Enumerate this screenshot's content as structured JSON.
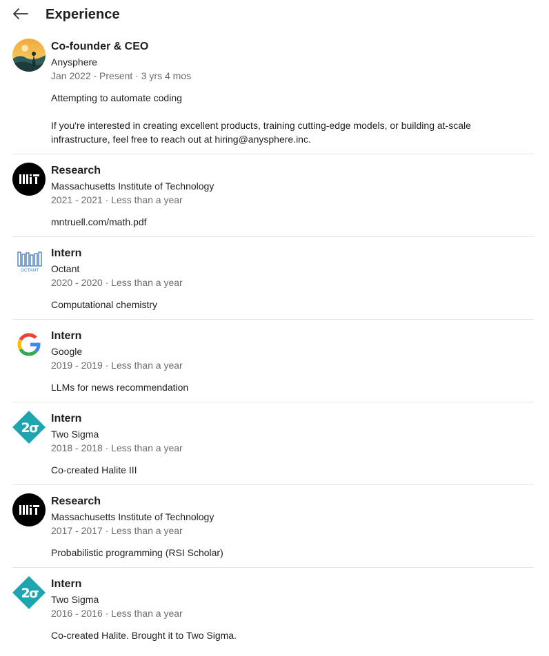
{
  "header": {
    "title": "Experience",
    "back_icon": "arrow-left-icon"
  },
  "experiences": [
    {
      "role": "Co-founder & CEO",
      "company": "Anysphere",
      "dates": "Jan 2022 - Present · 3 yrs 4 mos",
      "desc1": "Attempting to automate coding",
      "desc2": "If you're interested in creating excellent products, training cutting-edge models, or building at-scale",
      "desc3": "infrastructure, feel free to reach out at hiring@anysphere.inc.",
      "logo": "anysphere-logo"
    },
    {
      "role": "Research",
      "company": "Massachusetts Institute of Technology",
      "dates": "2021 - 2021 · Less than a year",
      "desc1": "mntruell.com/math.pdf",
      "logo": "mit-logo"
    },
    {
      "role": "Intern",
      "company": "Octant",
      "dates": "2020 - 2020 · Less than a year",
      "desc1": "Computational chemistry",
      "logo": "octant-logo",
      "logo_text": "OCTANT"
    },
    {
      "role": "Intern",
      "company": "Google",
      "dates": "2019 - 2019 · Less than a year",
      "desc1": "LLMs for news recommendation",
      "logo": "google-logo"
    },
    {
      "role": "Intern",
      "company": "Two Sigma",
      "dates": "2018 - 2018 · Less than a year",
      "desc1": "Co-created Halite III",
      "logo": "two-sigma-logo"
    },
    {
      "role": "Research",
      "company": "Massachusetts Institute of Technology",
      "dates": "2017 - 2017 · Less than a year",
      "desc1": "Probabilistic programming (RSI Scholar)",
      "logo": "mit-logo"
    },
    {
      "role": "Intern",
      "company": "Two Sigma",
      "dates": "2016 - 2016 · Less than a year",
      "desc1": "Co-created Halite. Brought it to Two Sigma.",
      "logo": "two-sigma-logo"
    }
  ],
  "colors": {
    "two_sigma": "#1fa5b0",
    "mit": "#000000",
    "octant": "#4a7fc1",
    "muted_text": "#6b6b6b",
    "divider": "#e6e6e6"
  }
}
